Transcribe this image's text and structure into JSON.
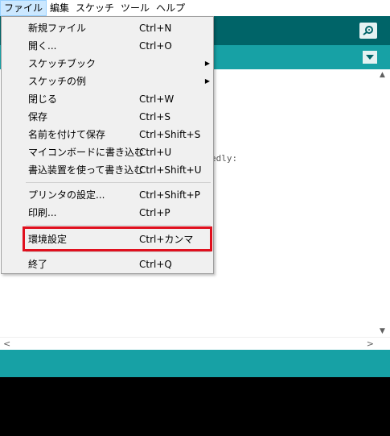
{
  "menubar": {
    "items": [
      "ファイル",
      "編集",
      "スケッチ",
      "ツール",
      "ヘルプ"
    ]
  },
  "editor": {
    "code_snippet": "edly:"
  },
  "file_menu": {
    "items": [
      {
        "label": "新規ファイル",
        "shortcut": "Ctrl+N"
      },
      {
        "label": "開く...",
        "shortcut": "Ctrl+O"
      },
      {
        "label": "スケッチブック",
        "shortcut": ""
      },
      {
        "label": "スケッチの例",
        "shortcut": ""
      },
      {
        "label": "閉じる",
        "shortcut": "Ctrl+W"
      },
      {
        "label": "保存",
        "shortcut": "Ctrl+S"
      },
      {
        "label": "名前を付けて保存",
        "shortcut": "Ctrl+Shift+S"
      },
      {
        "label": "マイコンボードに書き込む",
        "shortcut": "Ctrl+U"
      },
      {
        "label": "書込装置を使って書き込む",
        "shortcut": "Ctrl+Shift+U"
      },
      {
        "label": "プリンタの設定...",
        "shortcut": "Ctrl+Shift+P"
      },
      {
        "label": "印刷...",
        "shortcut": "Ctrl+P"
      },
      {
        "label": "環境設定",
        "shortcut": "Ctrl+カンマ"
      },
      {
        "label": "終了",
        "shortcut": "Ctrl+Q"
      }
    ],
    "submenu_arrow": "▶"
  },
  "icons": {
    "serial_monitor": "magnifier-icon",
    "tab_menu": "chevron-down-icon"
  },
  "colors": {
    "toolbar": "#006468",
    "tabstrip": "#17a1a5",
    "highlight": "#e0101e"
  }
}
